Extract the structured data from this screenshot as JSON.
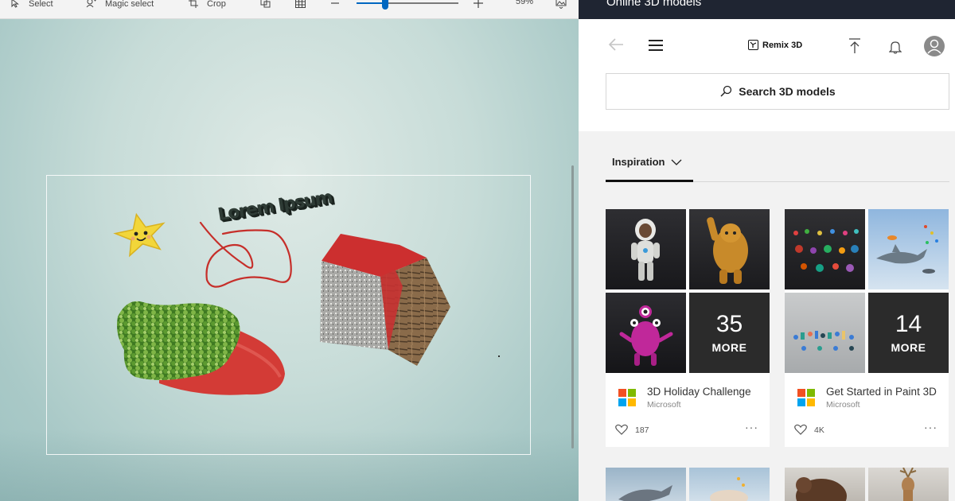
{
  "toolbar": {
    "select_label": "Select",
    "magic_select_label": "Magic select",
    "crop_label": "Crop",
    "zoom_value": "59%",
    "zoom_fraction": 0.28
  },
  "canvas": {
    "text_sticker": "Lorem Ipsum"
  },
  "panel": {
    "title": "Online 3D models",
    "remix_label": "Remix 3D",
    "search_label": "Search 3D models",
    "tab_label": "Inspiration"
  },
  "cards": [
    {
      "more_count": "35",
      "more_label": "MORE",
      "title": "3D Holiday Challenge",
      "author": "Microsoft",
      "likes": "187"
    },
    {
      "more_count": "14",
      "more_label": "MORE",
      "title": "Get Started in Paint 3D",
      "author": "Microsoft",
      "likes": "4K"
    }
  ],
  "colors": {
    "accent": "#0067c0",
    "header_bg": "#1f2532",
    "ms_red": "#f25022",
    "ms_green": "#7fba00",
    "ms_blue": "#00a4ef",
    "ms_yellow": "#ffb900"
  }
}
